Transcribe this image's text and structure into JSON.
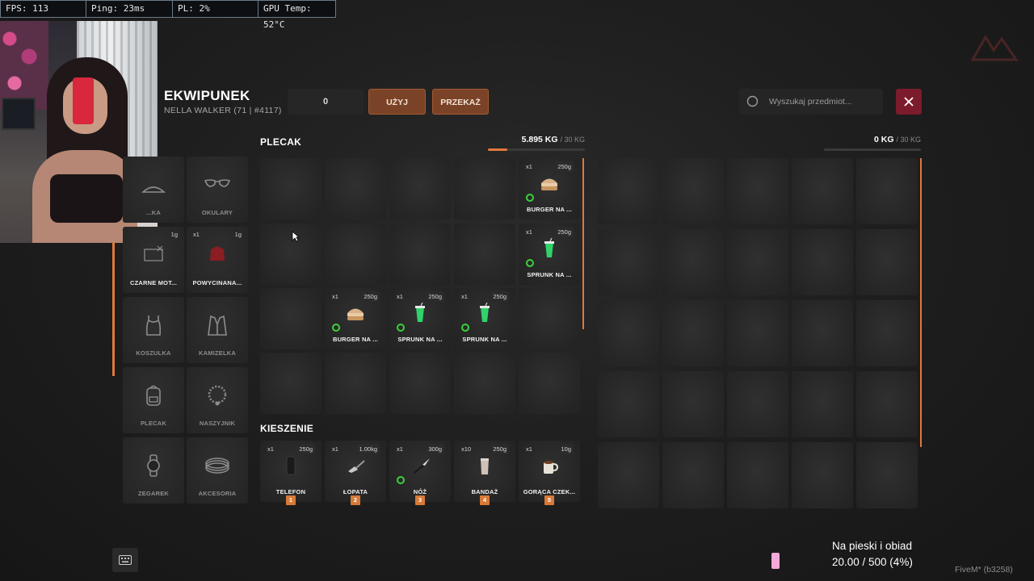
{
  "overlay": {
    "fps": "FPS: 113",
    "ping": "Ping: 23ms",
    "pl": "PL: 2%",
    "gpu": "GPU Temp: 52°C"
  },
  "header": {
    "title": "EKWIPUNEK",
    "subtitle": "NELLA WALKER (71 | #4117)",
    "amount_value": "0",
    "use_label": "UŻYJ",
    "give_label": "PRZEKAŻ",
    "search_placeholder": "Wyszukaj przedmiot...",
    "close_icon": "close-icon"
  },
  "equipment": [
    {
      "label": "...KA",
      "icon": "hat-icon",
      "qty": "",
      "weight": ""
    },
    {
      "label": "OKULARY",
      "icon": "glasses-icon",
      "qty": "",
      "weight": ""
    },
    {
      "label": "CZARNE MOT...",
      "icon": "gloves-icon",
      "qty": "",
      "weight": "1g"
    },
    {
      "label": "POWYCINANA...",
      "icon": "top-icon",
      "qty": "x1",
      "weight": "1g"
    },
    {
      "label": "KOSZULKA",
      "icon": "tank-top-icon",
      "qty": "",
      "weight": ""
    },
    {
      "label": "KAMIZELKA",
      "icon": "vest-icon",
      "qty": "",
      "weight": ""
    },
    {
      "label": "PLECAK",
      "icon": "backpack-icon",
      "qty": "",
      "weight": ""
    },
    {
      "label": "NASZYJNIK",
      "icon": "necklace-icon",
      "qty": "",
      "weight": ""
    },
    {
      "label": "ZEGAREK",
      "icon": "watch-icon",
      "qty": "",
      "weight": ""
    },
    {
      "label": "AKCESORIA",
      "icon": "bracelet-icon",
      "qty": "",
      "weight": ""
    }
  ],
  "backpack": {
    "title": "PLECAK",
    "weight": "5.895 KG",
    "max": "/ 30 KG",
    "fill_fraction": 0.197,
    "slots": [
      null,
      null,
      null,
      null,
      {
        "qty": "x1",
        "weight": "250g",
        "name": "BURGER NA ...",
        "icon": "burger-icon"
      },
      null,
      null,
      null,
      null,
      {
        "qty": "x1",
        "weight": "250g",
        "name": "SPRUNK NA ...",
        "icon": "cup-icon"
      },
      null,
      {
        "qty": "x1",
        "weight": "250g",
        "name": "BURGER NA ...",
        "icon": "burger-icon"
      },
      {
        "qty": "x1",
        "weight": "250g",
        "name": "SPRUNK NA ...",
        "icon": "cup-icon"
      },
      {
        "qty": "x1",
        "weight": "250g",
        "name": "SPRUNK NA ...",
        "icon": "cup-icon"
      },
      null,
      null,
      null,
      null,
      null,
      null
    ]
  },
  "pockets": {
    "title": "KIESZENIE",
    "slots": [
      {
        "qty": "x1",
        "weight": "250g",
        "name": "TELEFON",
        "key": "1",
        "icon": "phone-icon",
        "ring": false
      },
      {
        "qty": "x1",
        "weight": "1.00kg",
        "name": "ŁOPATA",
        "key": "2",
        "icon": "shovel-icon",
        "ring": false
      },
      {
        "qty": "x1",
        "weight": "300g",
        "name": "NÓŻ",
        "key": "3",
        "icon": "knife-icon",
        "ring": true
      },
      {
        "qty": "x10",
        "weight": "250g",
        "name": "BANDAŻ",
        "key": "4",
        "icon": "bandage-icon",
        "ring": false
      },
      {
        "qty": "x1",
        "weight": "10g",
        "name": "GORĄCA CZEK...",
        "key": "5",
        "icon": "mug-icon",
        "ring": false
      }
    ]
  },
  "ground": {
    "weight": "0 KG",
    "max": "/ 30 KG",
    "fill_fraction": 0
  },
  "status": {
    "line1": "Na pieski i obiad",
    "line2": "20.00 / 500 (4%)"
  },
  "footer": {
    "build": "FiveM* (b3258)"
  },
  "colors": {
    "accent": "#e0783a",
    "button": "#7a4327",
    "close": "#7b1b2c",
    "ring": "#3bd23b"
  }
}
